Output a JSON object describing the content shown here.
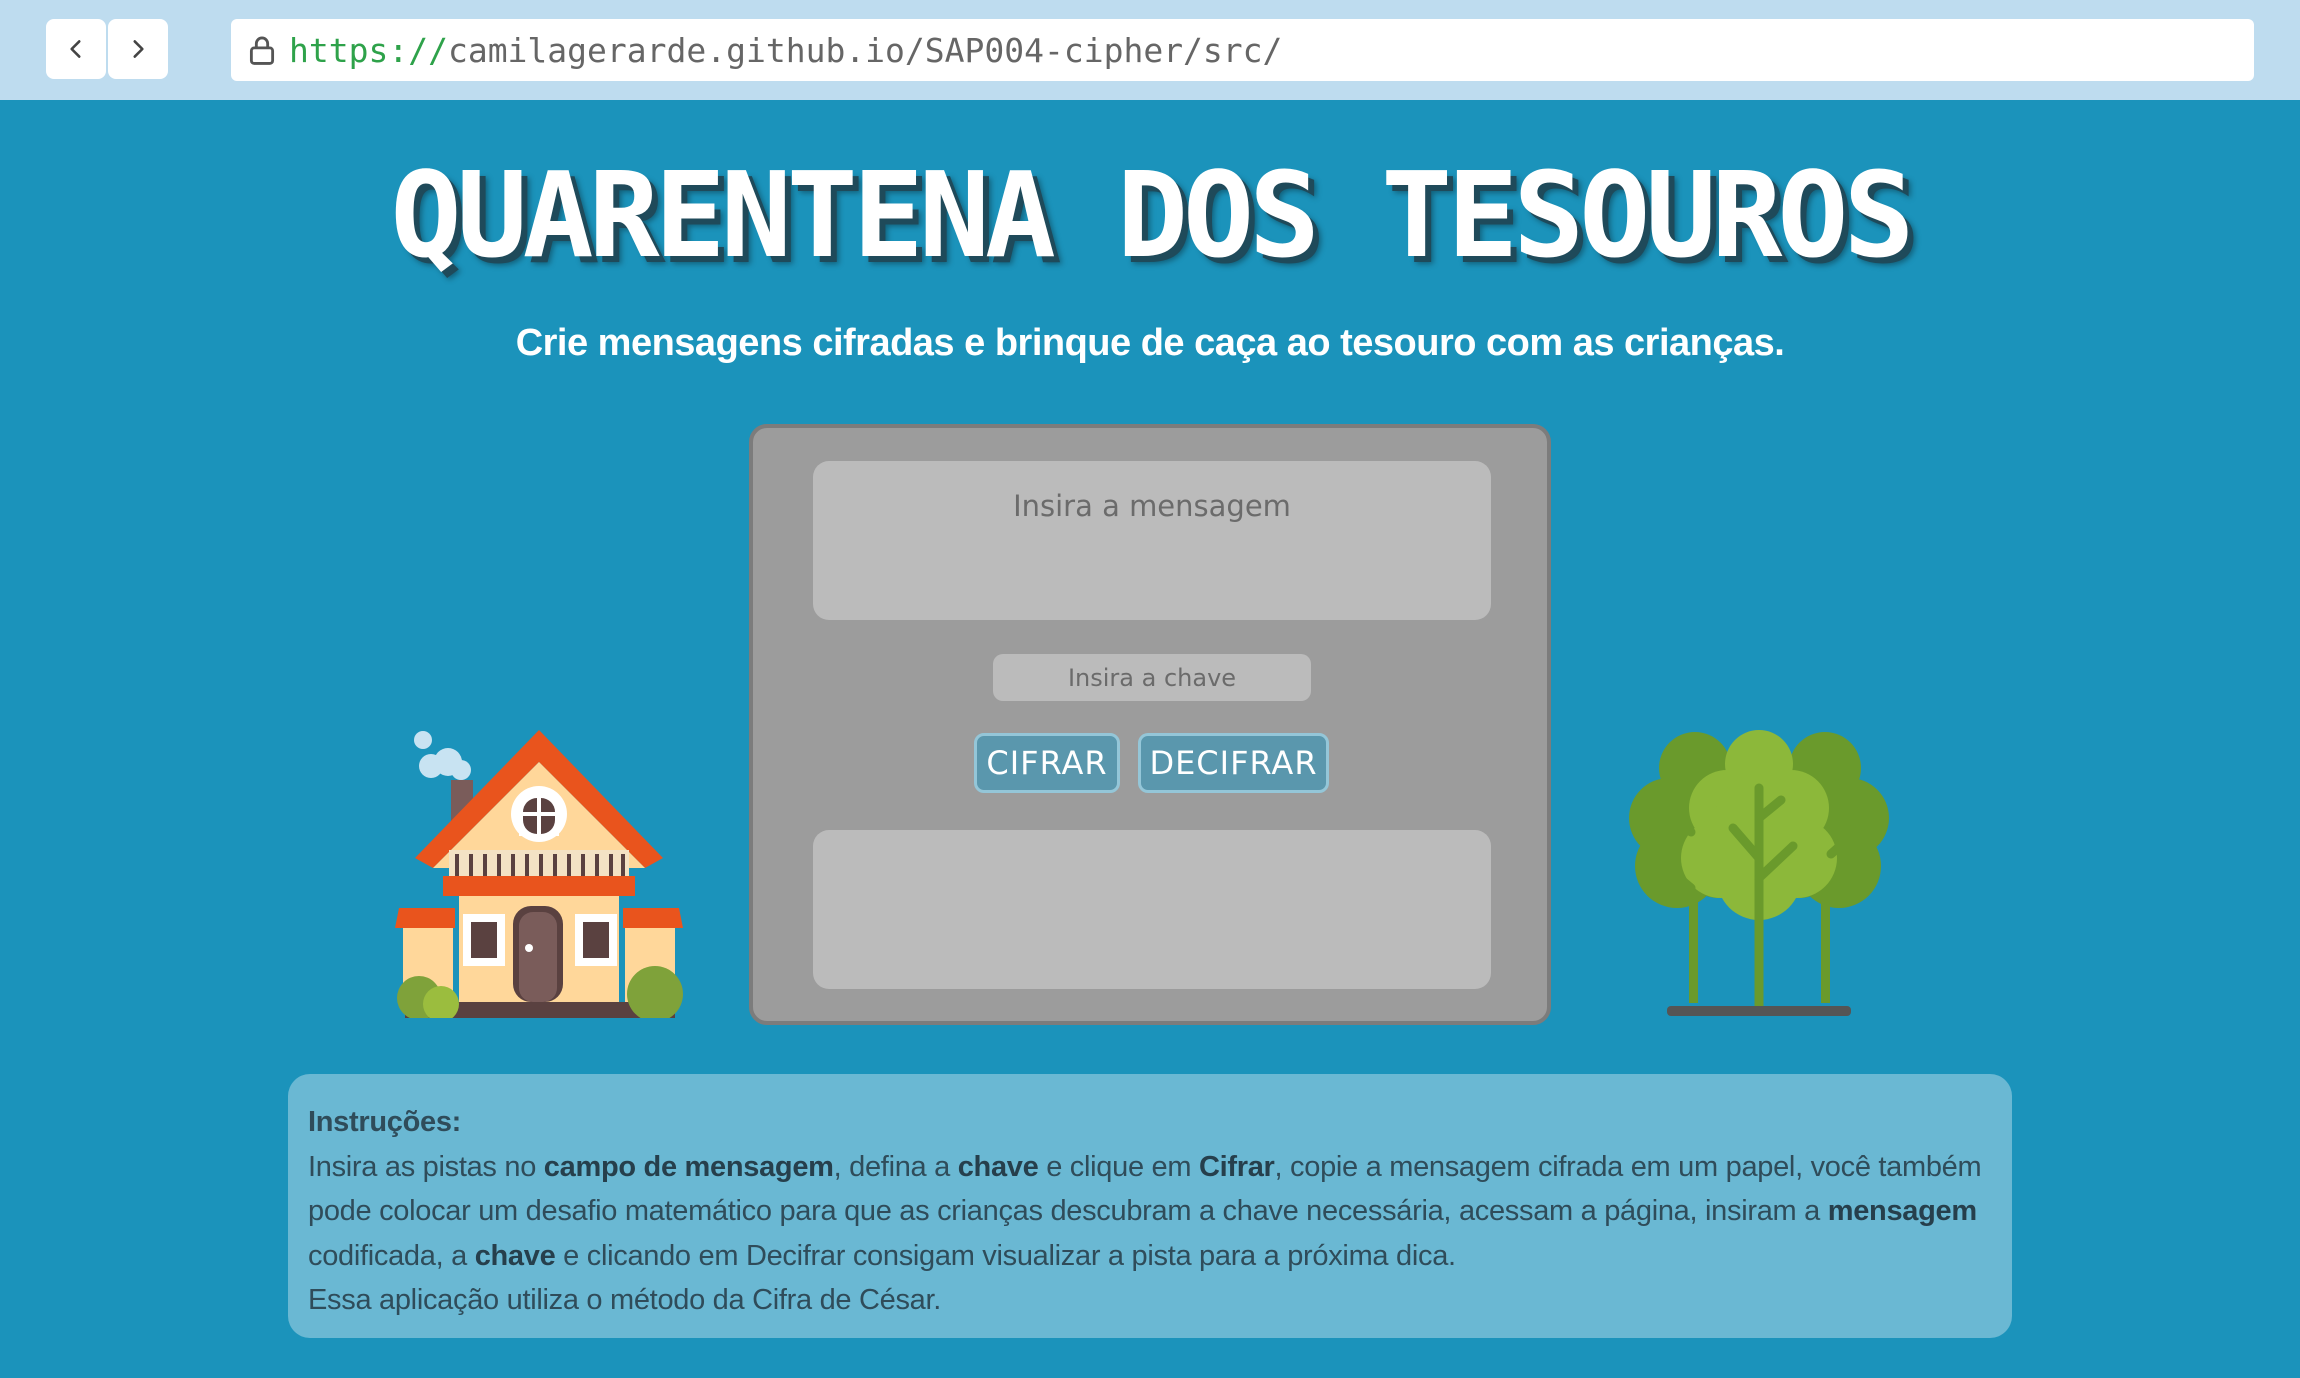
{
  "browser": {
    "url_scheme": "https://",
    "url_rest": "camilagerarde.github.io/SAP004-cipher/src/"
  },
  "page": {
    "title": "QUARENTENA DOS TESOUROS",
    "subtitle": "Crie mensagens cifradas e brinque de caça ao tesouro com as crianças."
  },
  "form": {
    "message_placeholder": "Insira a mensagem",
    "key_placeholder": "Insira a chave",
    "cipher_label": "CIFRAR",
    "decipher_label": "DECIFRAR",
    "output_value": ""
  },
  "instructions": {
    "heading": "Instruções:",
    "p1_a": "Insira as pistas no ",
    "p1_b": "campo de mensagem",
    "p1_c": ", defina a ",
    "p1_d": "chave",
    "p1_e": " e clique em ",
    "p1_f": "Cifrar",
    "p1_g": ", copie a mensagem cifrada em um papel, você também pode colocar um desafio matemático para que as crianças descubram a chave necessária, acessam a página, insiram a ",
    "p1_h": "mensagem",
    "p1_i": " codificada, a ",
    "p1_j": "chave",
    "p1_k": " e clicando em Decifrar consigam visualizar a pista para a próxima dica.",
    "p2": "Essa aplicação utiliza o método da Cifra de César."
  },
  "icons": {
    "back": "chevron-left-icon",
    "forward": "chevron-right-icon",
    "lock": "lock-icon"
  },
  "colors": {
    "background": "#1b93bb",
    "panel": "#9c9c9c",
    "button": "#5a97ad",
    "instructions_box": "#6ab8d3"
  }
}
